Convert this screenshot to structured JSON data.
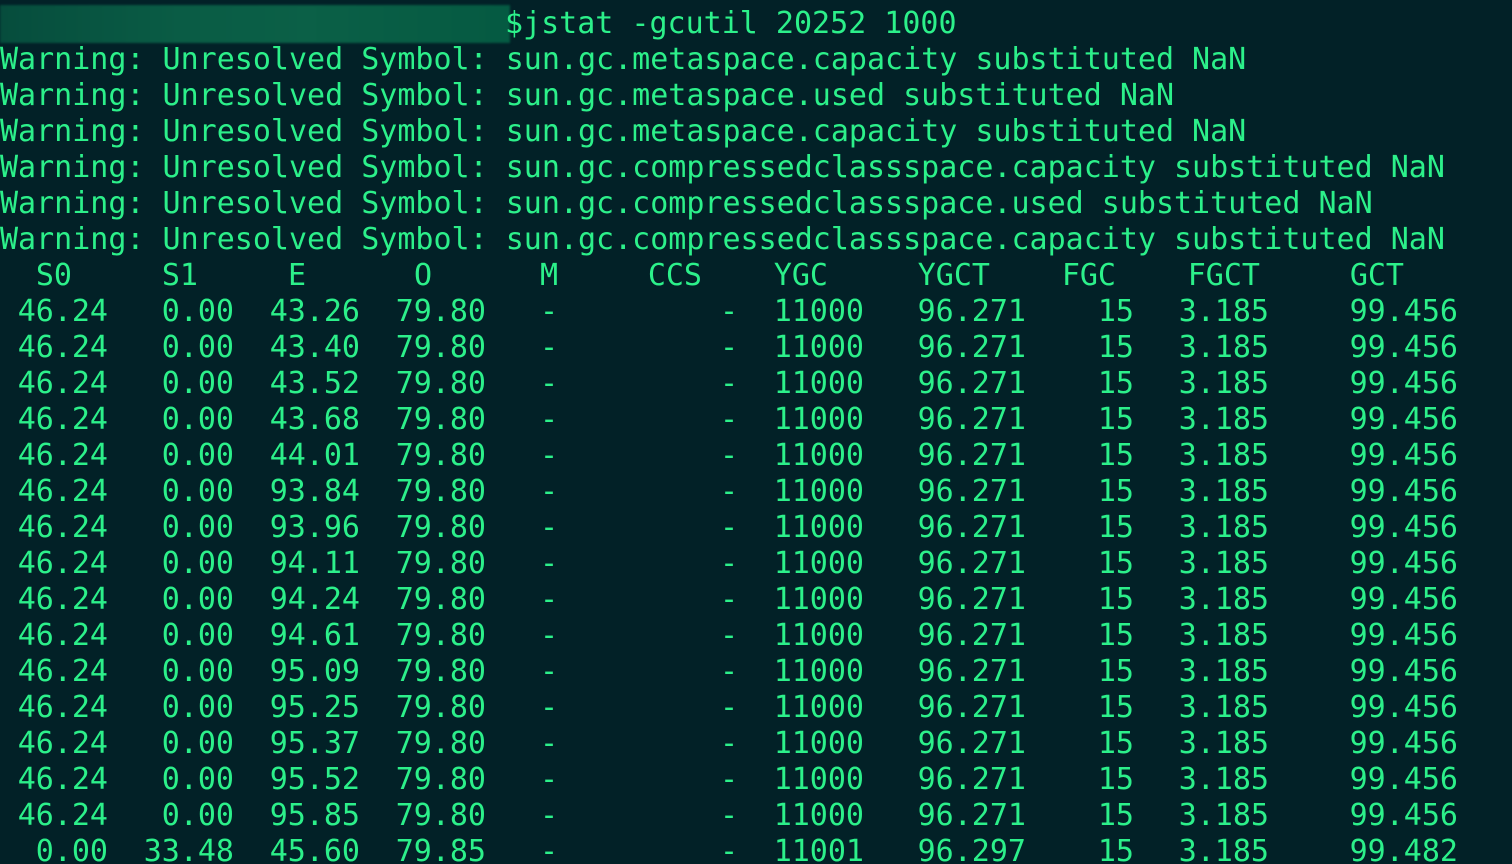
{
  "theme": {
    "background": "#022127",
    "foreground": "#2cf08a"
  },
  "prompt": {
    "redacted": true,
    "command": "$jstat -gcutil 20252 1000"
  },
  "warnings": [
    "Warning: Unresolved Symbol: sun.gc.metaspace.capacity substituted NaN",
    "Warning: Unresolved Symbol: sun.gc.metaspace.used substituted NaN",
    "Warning: Unresolved Symbol: sun.gc.metaspace.capacity substituted NaN",
    "Warning: Unresolved Symbol: sun.gc.compressedclassspace.capacity substituted NaN",
    "Warning: Unresolved Symbol: sun.gc.compressedclassspace.used substituted NaN",
    "Warning: Unresolved Symbol: sun.gc.compressedclassspace.capacity substituted NaN"
  ],
  "table": {
    "headers": [
      "S0",
      "S1",
      "E",
      "O",
      "M",
      "CCS",
      "YGC",
      "YGCT",
      "FGC",
      "FGCT",
      "GCT"
    ],
    "rows": [
      [
        "46.24",
        "0.00",
        "43.26",
        "79.80",
        "-",
        "-",
        "11000",
        "96.271",
        "15",
        "3.185",
        "99.456"
      ],
      [
        "46.24",
        "0.00",
        "43.40",
        "79.80",
        "-",
        "-",
        "11000",
        "96.271",
        "15",
        "3.185",
        "99.456"
      ],
      [
        "46.24",
        "0.00",
        "43.52",
        "79.80",
        "-",
        "-",
        "11000",
        "96.271",
        "15",
        "3.185",
        "99.456"
      ],
      [
        "46.24",
        "0.00",
        "43.68",
        "79.80",
        "-",
        "-",
        "11000",
        "96.271",
        "15",
        "3.185",
        "99.456"
      ],
      [
        "46.24",
        "0.00",
        "44.01",
        "79.80",
        "-",
        "-",
        "11000",
        "96.271",
        "15",
        "3.185",
        "99.456"
      ],
      [
        "46.24",
        "0.00",
        "93.84",
        "79.80",
        "-",
        "-",
        "11000",
        "96.271",
        "15",
        "3.185",
        "99.456"
      ],
      [
        "46.24",
        "0.00",
        "93.96",
        "79.80",
        "-",
        "-",
        "11000",
        "96.271",
        "15",
        "3.185",
        "99.456"
      ],
      [
        "46.24",
        "0.00",
        "94.11",
        "79.80",
        "-",
        "-",
        "11000",
        "96.271",
        "15",
        "3.185",
        "99.456"
      ],
      [
        "46.24",
        "0.00",
        "94.24",
        "79.80",
        "-",
        "-",
        "11000",
        "96.271",
        "15",
        "3.185",
        "99.456"
      ],
      [
        "46.24",
        "0.00",
        "94.61",
        "79.80",
        "-",
        "-",
        "11000",
        "96.271",
        "15",
        "3.185",
        "99.456"
      ],
      [
        "46.24",
        "0.00",
        "95.09",
        "79.80",
        "-",
        "-",
        "11000",
        "96.271",
        "15",
        "3.185",
        "99.456"
      ],
      [
        "46.24",
        "0.00",
        "95.25",
        "79.80",
        "-",
        "-",
        "11000",
        "96.271",
        "15",
        "3.185",
        "99.456"
      ],
      [
        "46.24",
        "0.00",
        "95.37",
        "79.80",
        "-",
        "-",
        "11000",
        "96.271",
        "15",
        "3.185",
        "99.456"
      ],
      [
        "46.24",
        "0.00",
        "95.52",
        "79.80",
        "-",
        "-",
        "11000",
        "96.271",
        "15",
        "3.185",
        "99.456"
      ],
      [
        "46.24",
        "0.00",
        "95.85",
        "79.80",
        "-",
        "-",
        "11000",
        "96.271",
        "15",
        "3.185",
        "99.456"
      ],
      [
        "0.00",
        "33.48",
        "45.60",
        "79.85",
        "-",
        "-",
        "11001",
        "96.297",
        "15",
        "3.185",
        "99.482"
      ]
    ]
  }
}
